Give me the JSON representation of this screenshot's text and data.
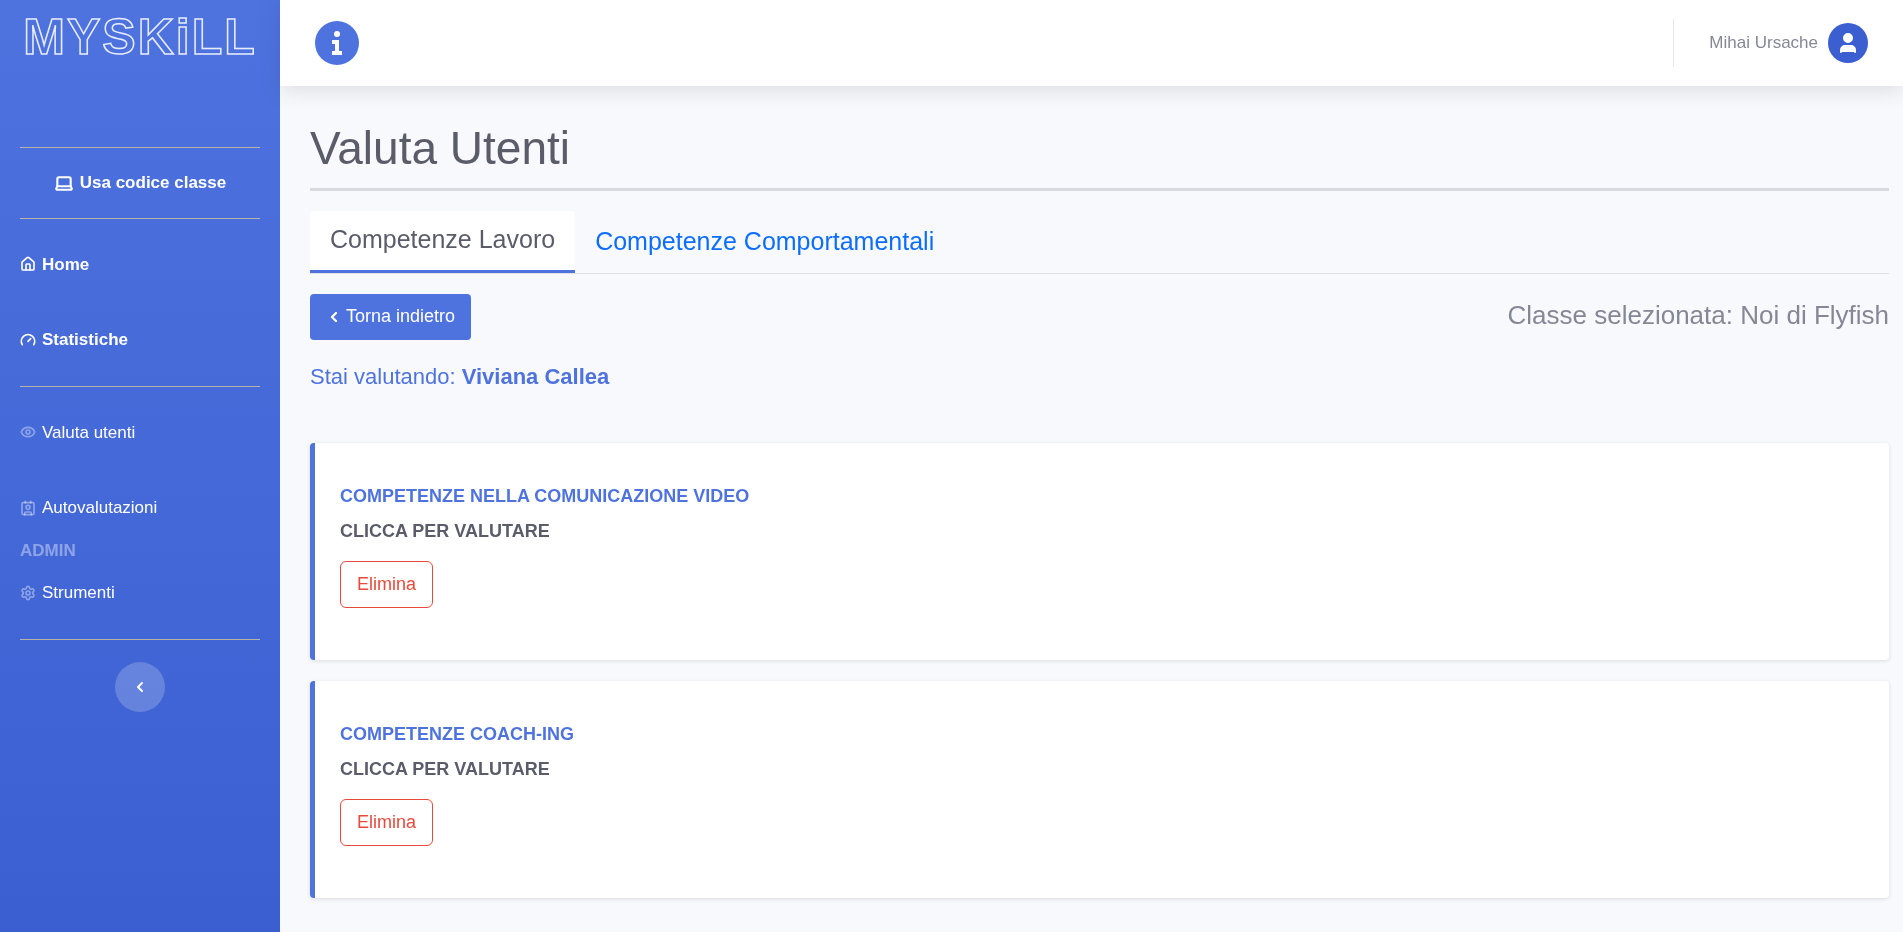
{
  "sidebar": {
    "logo": "MYSKiLL",
    "groups": [
      [
        {
          "kind": "action",
          "label": "Usa codice classe"
        }
      ],
      [
        {
          "kind": "main",
          "label": "Home"
        },
        {
          "kind": "main",
          "label": "Statistiche"
        }
      ],
      [
        {
          "kind": "sub",
          "label": "Valuta utenti"
        },
        {
          "kind": "sub",
          "label": "Autovalutazioni"
        },
        {
          "kind": "heading",
          "label": "ADMIN"
        },
        {
          "kind": "sub",
          "label": "Strumenti"
        }
      ]
    ]
  },
  "header": {
    "user_name": "Mihai Ursache"
  },
  "page": {
    "title": "Valuta Utenti",
    "tabs": [
      {
        "label": "Competenze Lavoro",
        "selected": true
      },
      {
        "label": "Competenze Comportamentali",
        "selected": false
      }
    ],
    "back_button": "Torna indietro",
    "selected_class": "Classe selezionata: Noi di Flyfish",
    "evaluating": "Stai valutando: **Viviana Callea**",
    "cards": [
      {
        "title": "COMPETENZE NELLA COMUNICAZIONE VIDEO",
        "subtitle": "CLICCA PER VALUTARE",
        "button": "Elimina"
      },
      {
        "title": "COMPETENZE COACH-ING",
        "subtitle": "CLICCA PER VALUTARE",
        "button": "Elimina"
      }
    ]
  }
}
